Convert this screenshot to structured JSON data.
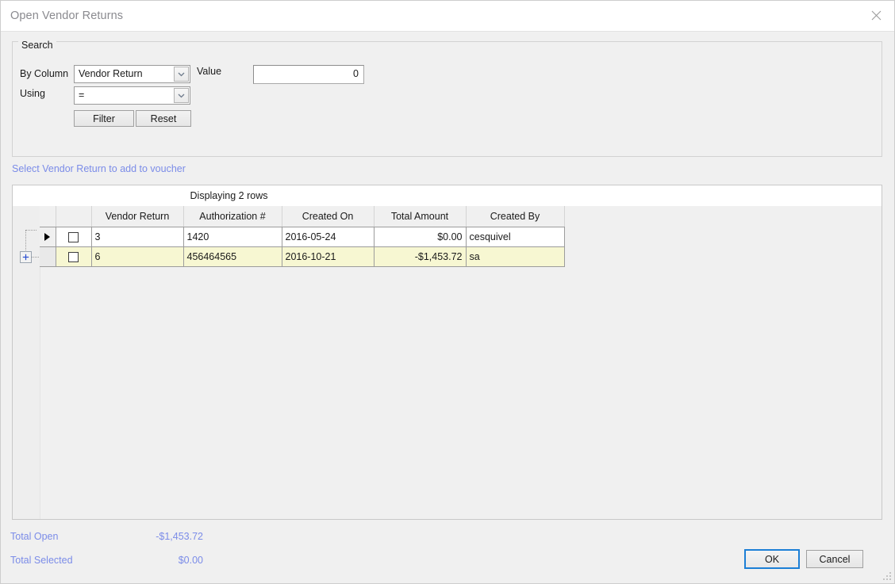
{
  "window": {
    "title": "Open Vendor Returns",
    "close_icon": "close-x-icon",
    "resize_grip": "resize-grip-icon"
  },
  "search": {
    "legend": "Search",
    "by_column_label": "By Column",
    "by_column_value": "Vendor Return",
    "using_label": "Using",
    "using_value": "=",
    "value_label": "Value",
    "value_input": "0",
    "value_placeholder": "0",
    "filter_button": "Filter",
    "reset_button": "Reset",
    "dropdown_icon": "chevron-down-icon"
  },
  "hint": {
    "text": "Select Vendor Return to add to voucher",
    "color": "#7b8ce8"
  },
  "grid": {
    "caption": "Displaying 2 rows",
    "expander_icon": "plus-expander-icon",
    "row_indicator_icon": "current-row-arrow-icon",
    "columns": [
      "",
      "",
      "Vendor Return",
      "Authorization #",
      "Created On",
      "Total Amount",
      "Created By"
    ],
    "rows": [
      {
        "indicator": true,
        "checked": false,
        "vendor_return": "3",
        "authorization": "1420",
        "created_on": "2016-05-24",
        "total_amount": "$0.00",
        "created_by": "cesquivel",
        "highlight": false
      },
      {
        "indicator": false,
        "checked": false,
        "vendor_return": "6",
        "authorization": "456464565",
        "created_on": "2016-10-21",
        "total_amount": "-$1,453.72",
        "created_by": "sa",
        "highlight": true
      }
    ]
  },
  "footer": {
    "total_open_label": "Total Open",
    "total_open_value": "-$1,453.72",
    "total_selected_label": "Total Selected",
    "total_selected_value": "$0.00",
    "ok_button": "OK",
    "cancel_button": "Cancel"
  },
  "colors": {
    "accent_focus": "#1c7fd6",
    "link": "#7b8ce8",
    "row_highlight": "#f7f7d2",
    "panel": "#f0f0f0"
  }
}
